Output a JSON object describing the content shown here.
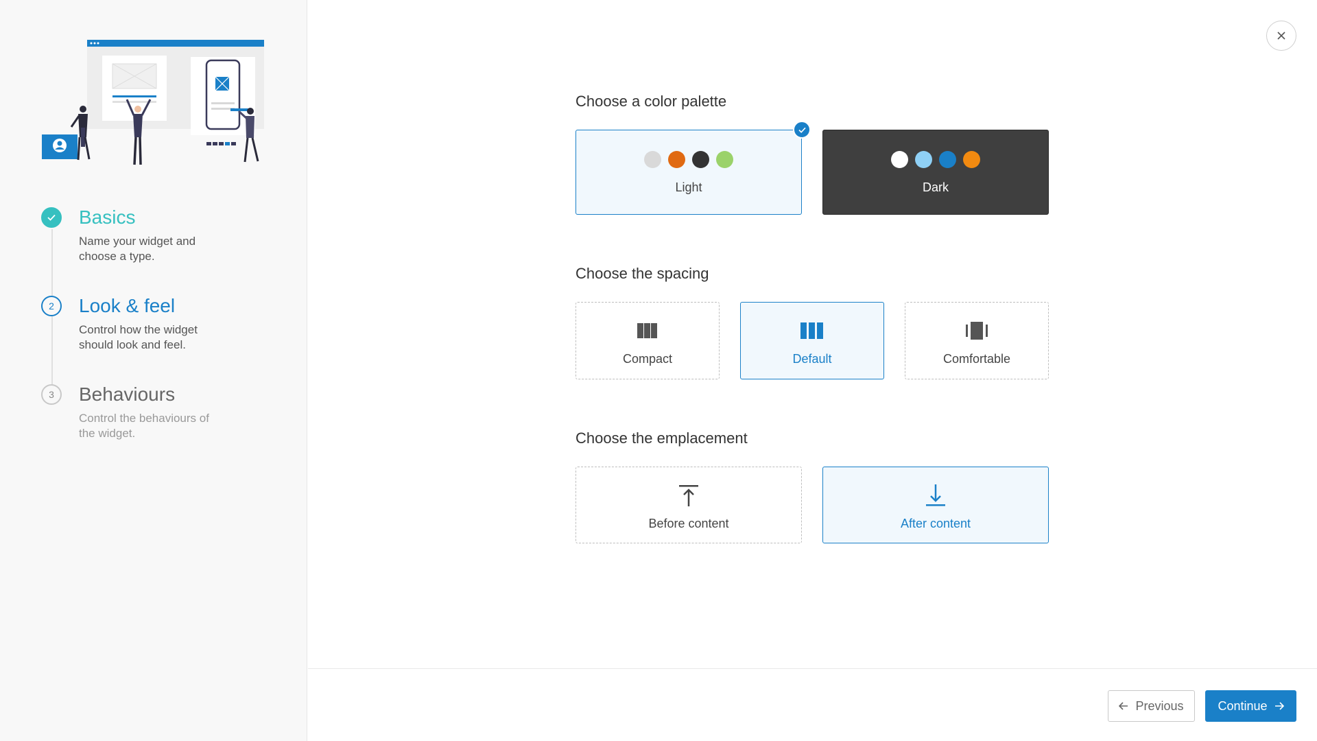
{
  "steps": [
    {
      "number": "",
      "title": "Basics",
      "description": "Name your widget and choose a type.",
      "state": "done"
    },
    {
      "number": "2",
      "title": "Look & feel",
      "description": "Control how the widget should look and feel.",
      "state": "active"
    },
    {
      "number": "3",
      "title": "Behaviours",
      "description": "Control the behaviours of the widget.",
      "state": "pending"
    }
  ],
  "palette": {
    "title": "Choose a color palette",
    "options": [
      {
        "label": "Light",
        "selected": true,
        "colors": [
          "#d9d9d9",
          "#e06a12",
          "#333333",
          "#9bd26a"
        ]
      },
      {
        "label": "Dark",
        "selected": false,
        "colors": [
          "#ffffff",
          "#8fd0f5",
          "#1a80c8",
          "#f28a10"
        ]
      }
    ]
  },
  "spacing": {
    "title": "Choose the spacing",
    "options": [
      {
        "label": "Compact",
        "icon": "compact-columns-icon",
        "selected": false
      },
      {
        "label": "Default",
        "icon": "default-columns-icon",
        "selected": true
      },
      {
        "label": "Comfortable",
        "icon": "comfortable-columns-icon",
        "selected": false
      }
    ]
  },
  "emplacement": {
    "title": "Choose the emplacement",
    "options": [
      {
        "label": "Before content",
        "icon": "arrow-to-top-icon",
        "selected": false
      },
      {
        "label": "After content",
        "icon": "arrow-to-bottom-icon",
        "selected": true
      }
    ]
  },
  "footer": {
    "previous_label": "Previous",
    "continue_label": "Continue"
  },
  "colors": {
    "accent": "#1a80c8",
    "done": "#36c0c0",
    "sidebar_bg": "#f8f8f8"
  }
}
